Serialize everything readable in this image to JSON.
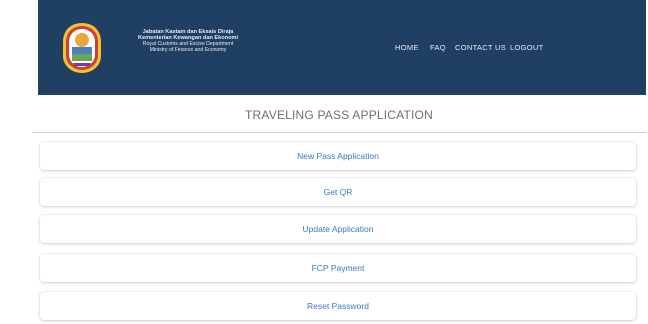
{
  "header": {
    "brand": {
      "line1": "Jabatan Kastam dan Eksais Diraja",
      "line2": "Kementerian Kewangan dan Ekonomi",
      "line3": "Royal Customs and Excise Department",
      "line4": "Ministry of Finance and Economy"
    },
    "nav": [
      {
        "label": "HOME"
      },
      {
        "label": "FAQ"
      },
      {
        "label": "CONTACT US"
      },
      {
        "label": "LOGOUT"
      }
    ]
  },
  "page": {
    "title": "TRAVELING PASS APPLICATION"
  },
  "menu": [
    {
      "label": "New Pass Application"
    },
    {
      "label": "Get QR"
    },
    {
      "label": "Update Application"
    },
    {
      "label": "FCP Payment"
    },
    {
      "label": "Reset Password"
    }
  ],
  "colors": {
    "header_bg": "#1f3f63",
    "link": "#3b78c4",
    "divider": "#b9d3ea"
  }
}
